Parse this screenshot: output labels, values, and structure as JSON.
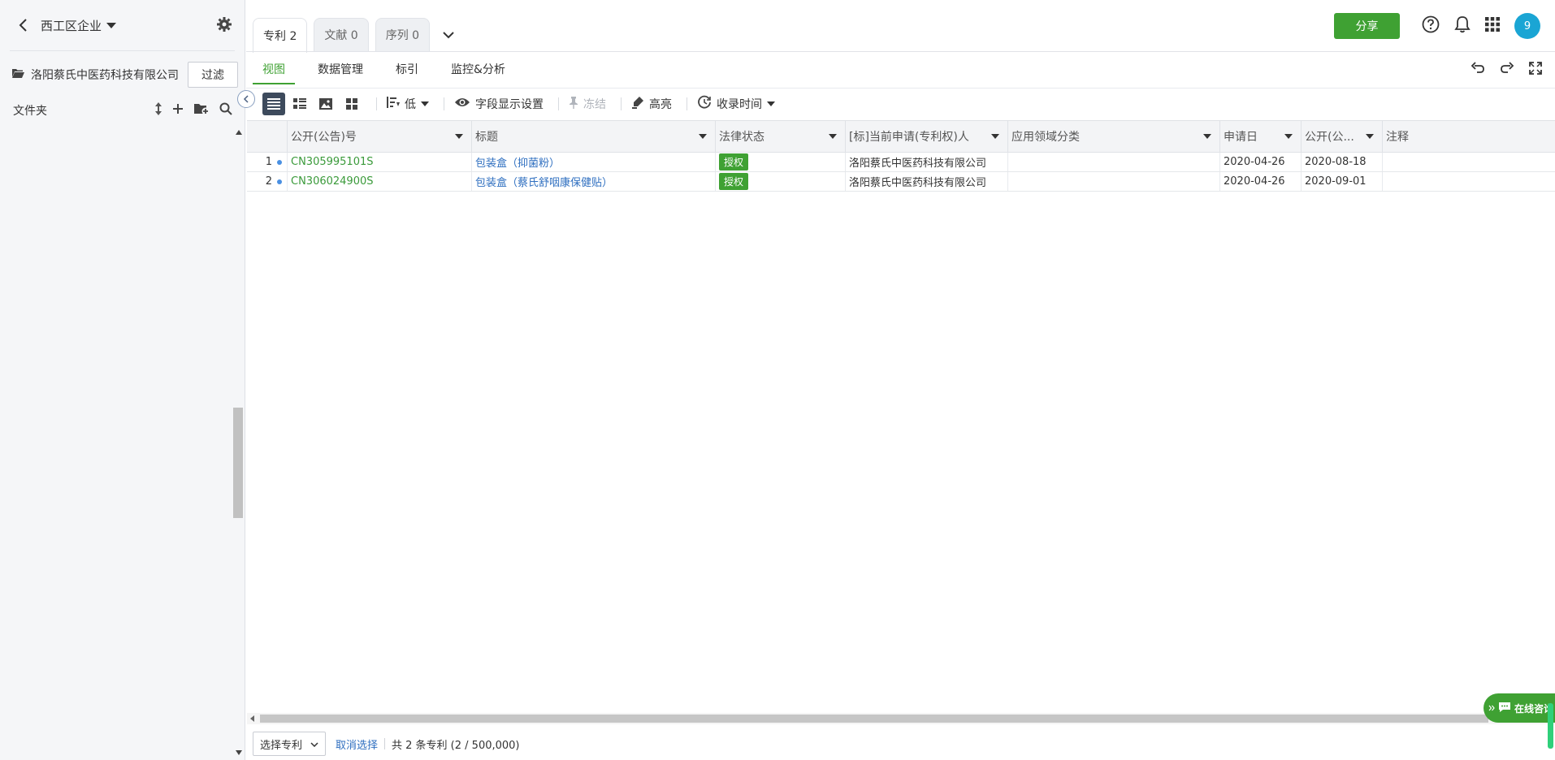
{
  "sidebar": {
    "company": "西工区企业",
    "folder_name": "洛阳蔡氏中医药科技有限公司",
    "filter_label": "过滤",
    "files_label": "文件夹"
  },
  "header": {
    "tabs": [
      {
        "label": "专利 2"
      },
      {
        "label": "文献 0"
      },
      {
        "label": "序列 0"
      }
    ],
    "share_label": "分享",
    "avatar_text": "9"
  },
  "subnav": {
    "items": [
      "视图",
      "数据管理",
      "标引",
      "监控&分析"
    ]
  },
  "toolbar": {
    "sort_label": "低",
    "fields_label": "字段显示设置",
    "freeze_label": "冻结",
    "highlight_label": "高亮",
    "time_label": "收录时间"
  },
  "table": {
    "columns": [
      "公开(公告)号",
      "标题",
      "法律状态",
      "[标]当前申请(专利权)人",
      "应用领域分类",
      "申请日",
      "公开(公...",
      "注释"
    ],
    "rows": [
      {
        "num": "1",
        "pub_no": "CN305995101S",
        "title": "包装盒（抑菌粉）",
        "status": "授权",
        "applicant": "洛阳蔡氏中医药科技有限公司",
        "field": "",
        "app_date": "2020-04-26",
        "pub_date": "2020-08-18",
        "note": ""
      },
      {
        "num": "2",
        "pub_no": "CN306024900S",
        "title": "包装盒（蔡氏舒咽康保健贴）",
        "status": "授权",
        "applicant": "洛阳蔡氏中医药科技有限公司",
        "field": "",
        "app_date": "2020-04-26",
        "pub_date": "2020-09-01",
        "note": ""
      }
    ]
  },
  "footer": {
    "select_label": "选择专利",
    "cancel_label": "取消选择",
    "count_text": "共 2 条专利 (2 / 500,000)"
  },
  "chat": {
    "label": "在线咨询"
  }
}
